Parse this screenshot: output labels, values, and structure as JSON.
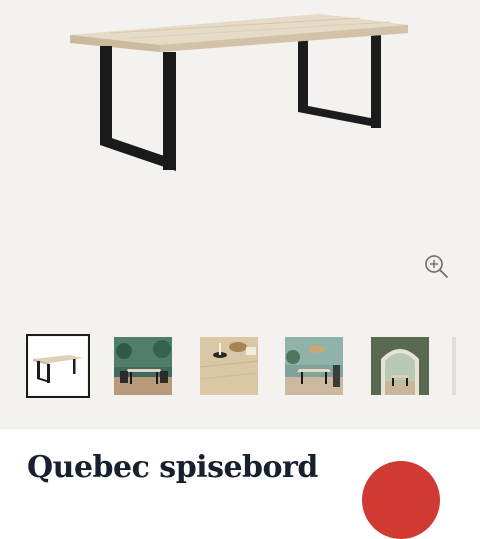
{
  "product": {
    "title": "Quebec spisebord",
    "image_description": "dining table with light oak top and black metal frame legs",
    "zoom_icon": "zoom-in-icon"
  },
  "gallery": {
    "selected_index": 0,
    "thumbnails": [
      {
        "icon": "table-product-photo"
      },
      {
        "icon": "dining-room-scene"
      },
      {
        "icon": "tabletop-detail"
      },
      {
        "icon": "dining-room-scene"
      },
      {
        "icon": "arched-alcove-scene"
      }
    ]
  },
  "colors": {
    "hero_background": "#f4f2ef",
    "title": "#16202e",
    "badge": "#cf3b32",
    "wood": "#ddcfb8",
    "metal": "#1c1c1c"
  }
}
